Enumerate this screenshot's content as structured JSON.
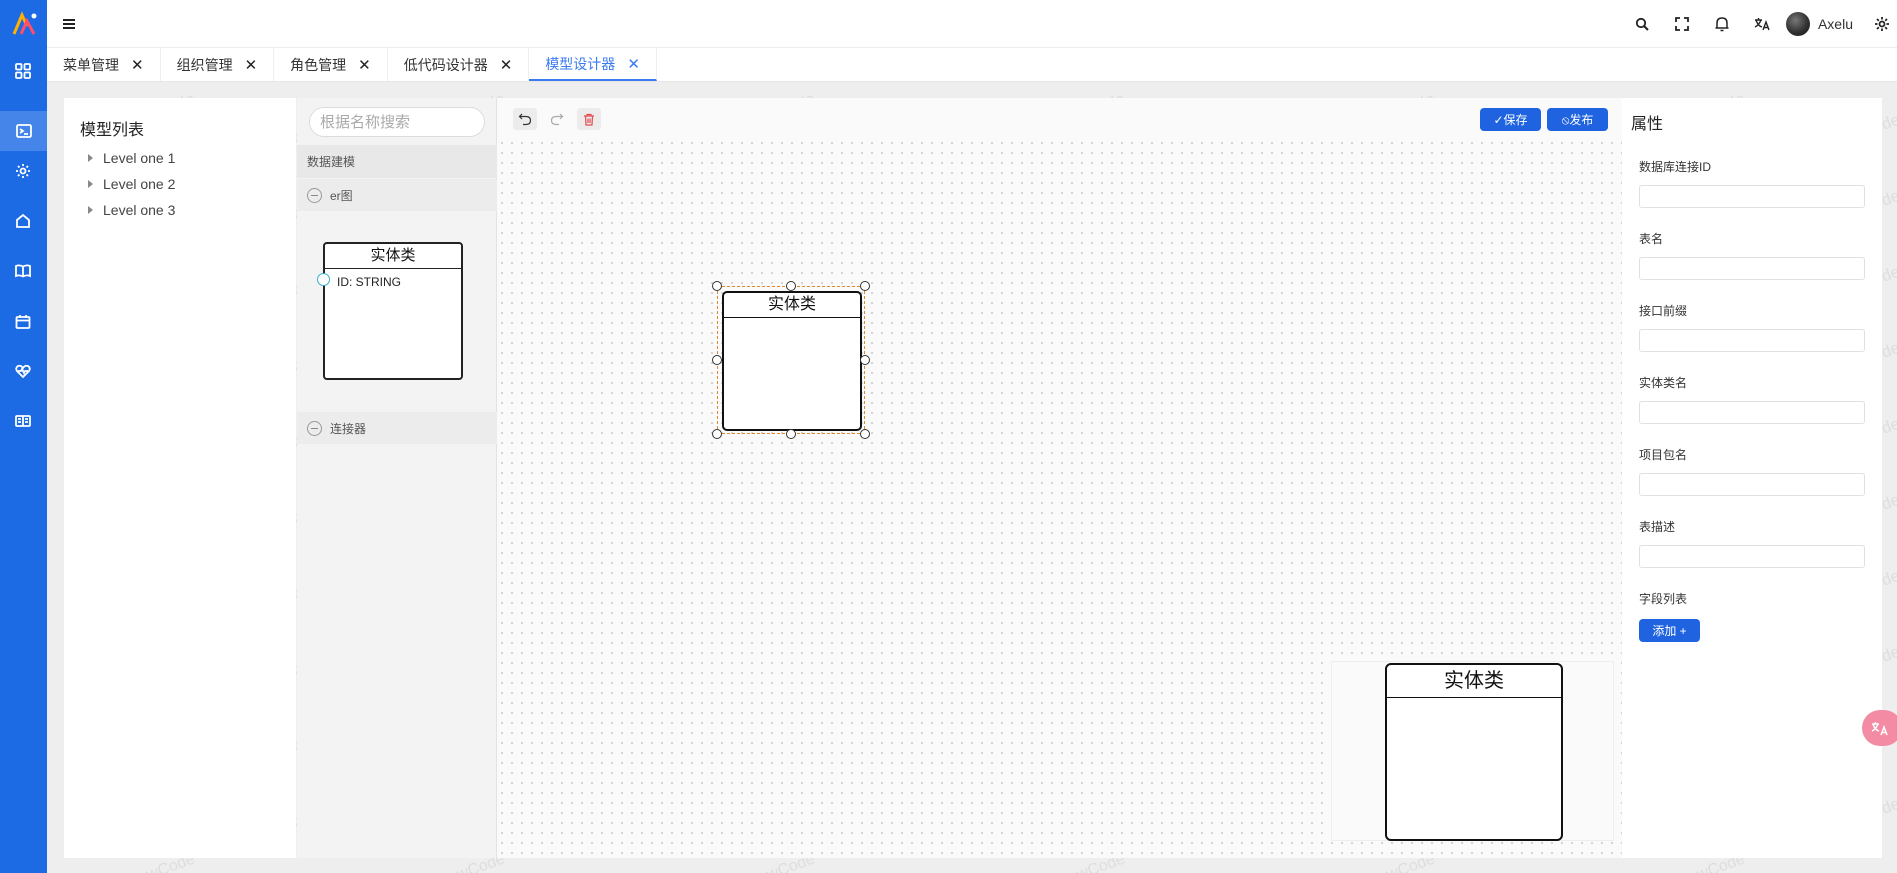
{
  "nav": {
    "items": [
      {
        "name": "dashboard",
        "icon": "grid-icon"
      },
      {
        "name": "terminal",
        "icon": "terminal-icon"
      },
      {
        "name": "settings",
        "icon": "gear-icon"
      },
      {
        "name": "home",
        "icon": "home-icon"
      },
      {
        "name": "docs",
        "icon": "book-icon"
      },
      {
        "name": "calendar",
        "icon": "calendar-icon"
      },
      {
        "name": "health",
        "icon": "heart-pulse-icon"
      },
      {
        "name": "manual",
        "icon": "open-book-icon"
      }
    ],
    "active_index": 1,
    "color": "#1d6ae5"
  },
  "header": {
    "user_name": "Axelu",
    "icons": [
      "search-icon",
      "fullscreen-icon",
      "bell-icon",
      "translate-icon",
      "settings-icon"
    ]
  },
  "tabs": [
    {
      "label": "菜单管理",
      "active": false
    },
    {
      "label": "组织管理",
      "active": false
    },
    {
      "label": "角色管理",
      "active": false
    },
    {
      "label": "低代码设计器",
      "active": false
    },
    {
      "label": "模型设计器",
      "active": true
    }
  ],
  "model_list": {
    "title": "模型列表",
    "items": [
      "Level one 1",
      "Level one 2",
      "Level one 3"
    ]
  },
  "stencil": {
    "search_placeholder": "根据名称搜索",
    "group_title": "数据建模",
    "sections": [
      "er图",
      "连接器"
    ],
    "entity_shape": {
      "title": "实体类",
      "field": "ID: STRING"
    }
  },
  "canvas": {
    "node_title": "实体类",
    "minimap_node_title": "实体类",
    "save_label": "✓保存",
    "publish_label": "⦸发布"
  },
  "properties": {
    "title": "属性",
    "fields": [
      "数据库连接ID",
      "表名",
      "接口前缀",
      "实体类名",
      "项目包名",
      "表描述"
    ],
    "field_list_label": "字段列表",
    "add_label": "添加 +"
  },
  "watermark": "AiLowCode",
  "accent_color": "#1f63e0",
  "selection_color": "#e08a2e"
}
